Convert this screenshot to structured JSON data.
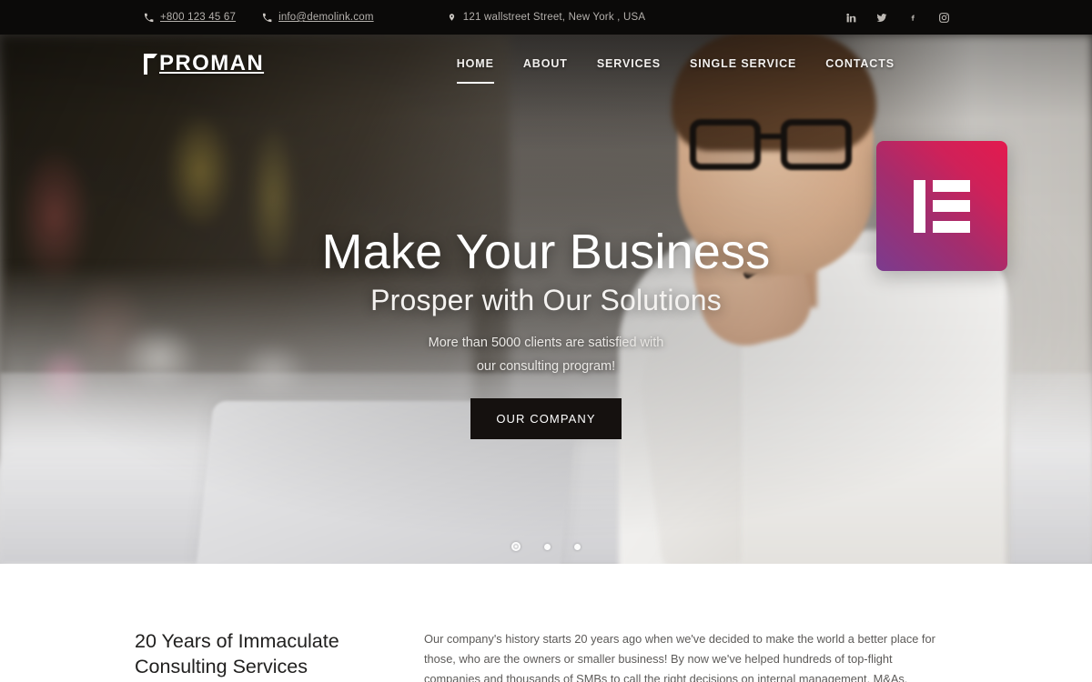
{
  "topbar": {
    "phone": "+800 123 45 67",
    "phone_icon": "phone-icon",
    "email": "info@demolink.com",
    "email_icon": "envelope-icon",
    "address": "121 wallstreet Street, New York , USA",
    "address_icon": "map-pin-icon",
    "social": [
      {
        "name": "linkedin-icon",
        "label": "in"
      },
      {
        "name": "twitter-icon",
        "label": "Twitter"
      },
      {
        "name": "facebook-icon",
        "label": "f"
      },
      {
        "name": "instagram-icon",
        "label": "Instagram"
      }
    ],
    "bg_color": "#0b0a09"
  },
  "header": {
    "logo": "PROMAN",
    "nav": [
      {
        "label": "HOME",
        "active": true
      },
      {
        "label": "ABOUT",
        "active": false
      },
      {
        "label": "SERVICES",
        "active": false
      },
      {
        "label": "SINGLE SERVICE",
        "active": false
      },
      {
        "label": "CONTACTS",
        "active": false
      }
    ],
    "search_icon": "search-icon"
  },
  "badge": {
    "name": "elementor-logo",
    "gradient_start": "#7b3b8e",
    "gradient_end": "#e31a4e"
  },
  "hero": {
    "title": "Make Your Business",
    "subtitle": "Prosper with Our Solutions",
    "description_line1": "More than 5000 clients are satisfied with",
    "description_line2": "our consulting program!",
    "button_label": "OUR COMPANY",
    "button_color": "#15110f",
    "slides": [
      {
        "active": true
      },
      {
        "active": false
      },
      {
        "active": false
      }
    ]
  },
  "about": {
    "heading": "20 Years of Immaculate Consulting Services",
    "paragraph": "Our company's history starts 20 years ago when we've decided to make the world a better place for those, who are the owners or smaller business! By now we've helped hundreds of top-flight companies and thousands of SMBs to call the right decisions on internal management, M&As,"
  }
}
